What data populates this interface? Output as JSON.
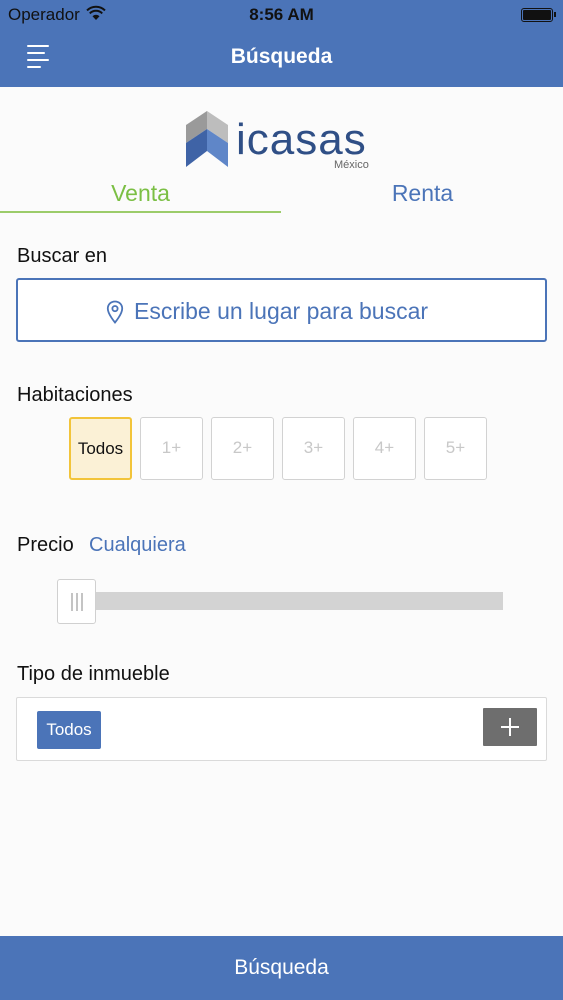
{
  "status_bar": {
    "carrier": "Operador",
    "time": "8:56 AM"
  },
  "navbar": {
    "title": "Búsqueda",
    "menu_icon": "hamburger-menu-icon"
  },
  "logo": {
    "brand": "icasas",
    "country": "México"
  },
  "tabs": [
    {
      "label": "Venta",
      "selected": true
    },
    {
      "label": "Renta",
      "selected": false
    }
  ],
  "search": {
    "label": "Buscar en",
    "placeholder": "Escribe un lugar para buscar",
    "icon": "location-pin-icon"
  },
  "rooms": {
    "label": "Habitaciones",
    "options": [
      "Todos",
      "1+",
      "2+",
      "3+",
      "4+",
      "5+"
    ],
    "selected": "Todos"
  },
  "price": {
    "label": "Precio",
    "value": "Cualquiera",
    "slider_level": 0
  },
  "property_type": {
    "label": "Tipo de inmueble",
    "chip": "Todos",
    "add_icon": "plus-icon"
  },
  "bottom_button": {
    "label": "Búsqueda"
  },
  "colors": {
    "primary": "#4b74b8",
    "accent_green": "#7bbf44",
    "selected_border": "#f2c43a",
    "selected_fill": "#fbf1d6"
  }
}
